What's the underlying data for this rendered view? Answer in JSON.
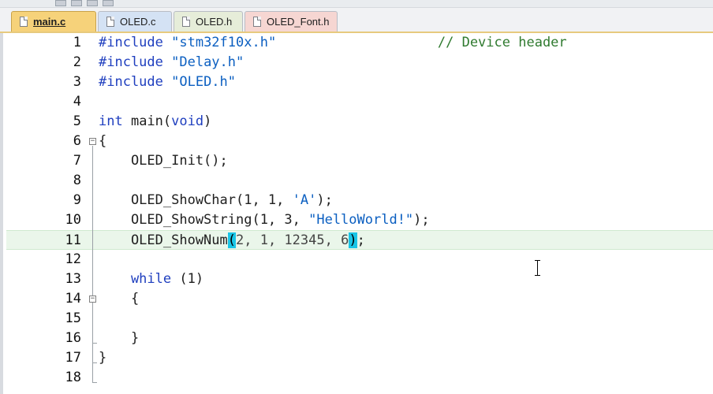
{
  "tabs": [
    {
      "label": "main.c",
      "active": true
    },
    {
      "label": "OLED.c",
      "active": false
    },
    {
      "label": "OLED.h",
      "active": false
    },
    {
      "label": "OLED_Font.h",
      "active": false
    }
  ],
  "lines": [
    {
      "n": "1",
      "a": "#include ",
      "b": "\"stm32f10x.h\"",
      "c": "                    // Device header"
    },
    {
      "n": "2",
      "a": "#include ",
      "b": "\"Delay.h\""
    },
    {
      "n": "3",
      "a": "#include ",
      "b": "\"OLED.h\""
    },
    {
      "n": "4"
    },
    {
      "n": "5",
      "a": "int",
      "b": " main(",
      "c": "void",
      "d": ")"
    },
    {
      "n": "6",
      "a": "{"
    },
    {
      "n": "7",
      "a": "    OLED_Init();"
    },
    {
      "n": "8"
    },
    {
      "n": "9",
      "a": "    OLED_ShowChar(1, 1, ",
      "b": "'A'",
      "c": ");"
    },
    {
      "n": "10",
      "a": "    OLED_ShowString(1, 3, ",
      "b": "\"HelloWorld!\"",
      "c": ");"
    },
    {
      "n": "11",
      "a": "    OLED_ShowNum",
      "b": "(",
      "c": "2, 1, 12345, 6",
      "d": ")",
      "e": ";"
    },
    {
      "n": "12"
    },
    {
      "n": "13",
      "a": "    while",
      "b": " (1)"
    },
    {
      "n": "14",
      "a": "    {"
    },
    {
      "n": "15"
    },
    {
      "n": "16",
      "a": "    }"
    },
    {
      "n": "17",
      "a": "}"
    },
    {
      "n": "18"
    }
  ],
  "colors": {
    "tab_active": "#f6d27a",
    "current_line": "#eaf6ea",
    "brace_match": "#19c5e6",
    "keyword": "#1f3fbf",
    "comment": "#2f7a2f"
  }
}
